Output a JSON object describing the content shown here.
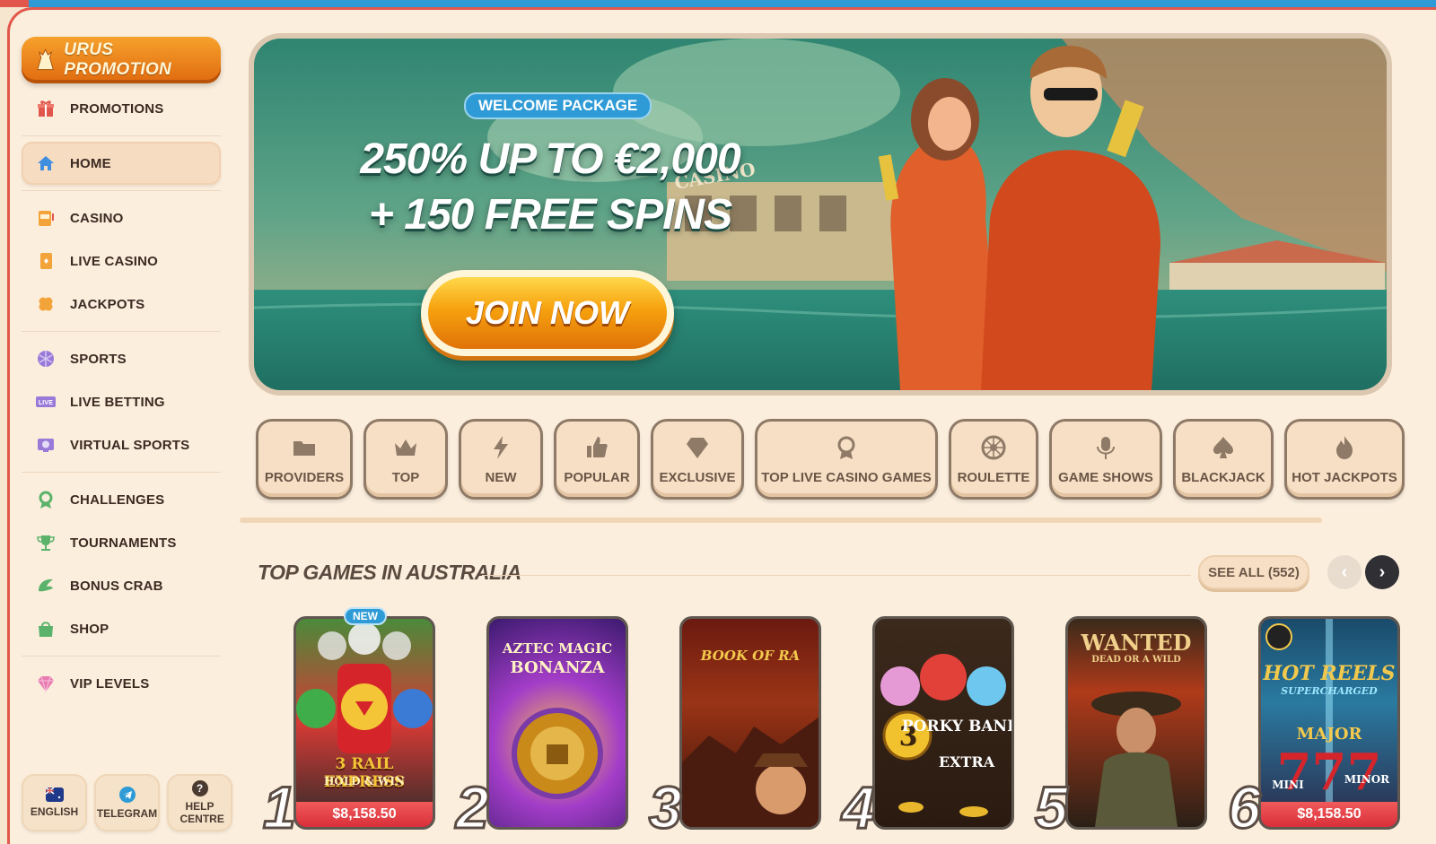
{
  "sidebar": {
    "promo_label": "URUS PROMOTION",
    "items": [
      {
        "label": "PROMOTIONS",
        "icon": "gift-icon"
      },
      {
        "label": "HOME",
        "icon": "home-icon"
      },
      {
        "label": "CASINO",
        "icon": "slot-machine-icon"
      },
      {
        "label": "LIVE CASINO",
        "icon": "card-icon"
      },
      {
        "label": "JACKPOTS",
        "icon": "clover-icon"
      },
      {
        "label": "SPORTS",
        "icon": "ball-icon"
      },
      {
        "label": "LIVE BETTING",
        "icon": "live-icon",
        "badge": "LIVE"
      },
      {
        "label": "VIRTUAL SPORTS",
        "icon": "virtual-sports-icon"
      },
      {
        "label": "CHALLENGES",
        "icon": "medal-icon"
      },
      {
        "label": "TOURNAMENTS",
        "icon": "trophy-icon"
      },
      {
        "label": "BONUS CRAB",
        "icon": "crab-claw-icon"
      },
      {
        "label": "SHOP",
        "icon": "shopping-bag-icon"
      },
      {
        "label": "VIP LEVELS",
        "icon": "diamond-icon"
      }
    ],
    "bottom": [
      {
        "label": "ENGLISH",
        "icon": "australia-flag-icon"
      },
      {
        "label": "TELEGRAM",
        "icon": "telegram-icon"
      },
      {
        "label": "HELP CENTRE",
        "icon": "help-icon",
        "icon_text": "?"
      }
    ]
  },
  "banner": {
    "tag": "WELCOME PACKAGE",
    "headline_line1": "250% UP TO €2,000",
    "headline_line2": "+ 150 FREE SPINS",
    "cta": "JOIN NOW",
    "sign_text": "CASINO"
  },
  "categories": [
    {
      "label": "PROVIDERS",
      "icon": "folder-icon"
    },
    {
      "label": "TOP",
      "icon": "crown-icon"
    },
    {
      "label": "NEW",
      "icon": "lightning-icon"
    },
    {
      "label": "POPULAR",
      "icon": "thumbs-up-icon"
    },
    {
      "label": "EXCLUSIVE",
      "icon": "diamond-icon"
    },
    {
      "label": "TOP LIVE CASINO GAMES",
      "icon": "award-icon"
    },
    {
      "label": "ROULETTE",
      "icon": "roulette-icon"
    },
    {
      "label": "GAME SHOWS",
      "icon": "microphone-icon"
    },
    {
      "label": "BLACKJACK",
      "icon": "spade-icon"
    },
    {
      "label": "HOT JACKPOTS",
      "icon": "fire-icon"
    }
  ],
  "section": {
    "title": "TOP GAMES IN AUSTRALIA",
    "see_all": "SEE ALL (552)",
    "prev": "‹",
    "next": "›"
  },
  "games": [
    {
      "rank": "1",
      "title": "3 RAIL EXPRESS",
      "subtitle": "HOLD & WIN",
      "badge": "NEW",
      "jackpot": "$8,158.50"
    },
    {
      "rank": "2",
      "title": "AZTEC MAGIC",
      "subtitle": "BONANZA"
    },
    {
      "rank": "3",
      "title": "BOOK OF RA"
    },
    {
      "rank": "4",
      "title": "PORKY BANKS",
      "subtitle": "EXTRA",
      "number": "3"
    },
    {
      "rank": "5",
      "title": "WANTED",
      "subtitle": "DEAD OR A WILD"
    },
    {
      "rank": "6",
      "title": "HOT REELS",
      "subtitle": "SUPERCHARGED",
      "extra1": "MAJOR",
      "extra2": "MINI",
      "extra3": "MINOR",
      "jackpot": "$8,158.50"
    }
  ]
}
